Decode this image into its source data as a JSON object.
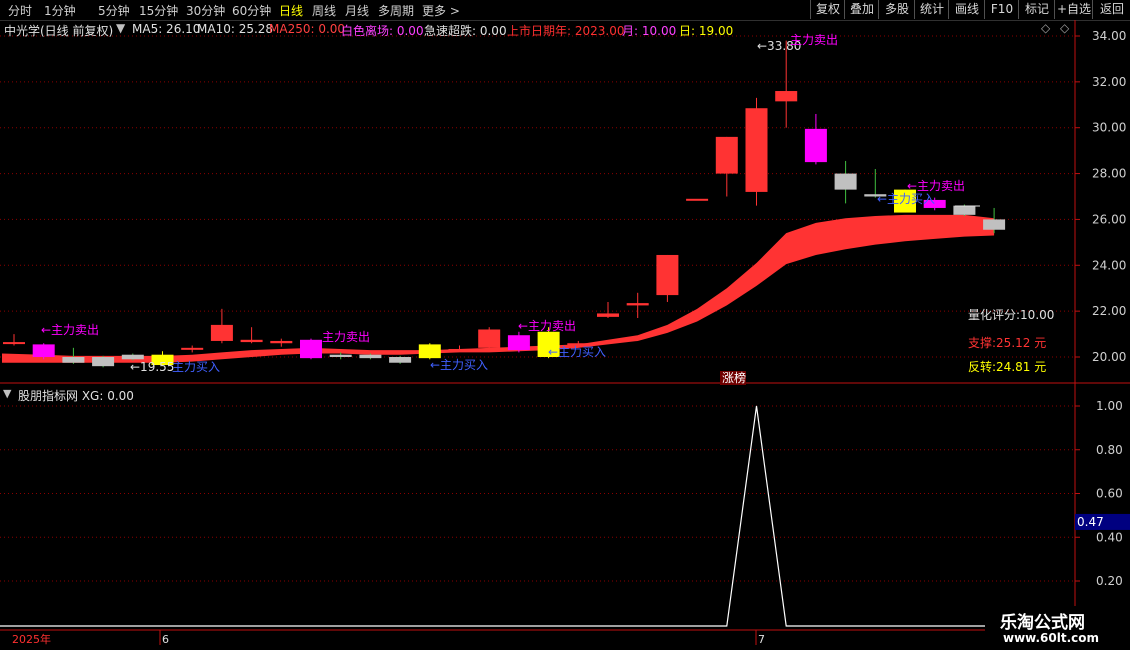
{
  "toolbar": {
    "tabs": [
      "分时",
      "1分钟",
      "5分钟",
      "15分钟",
      "30分钟",
      "60分钟",
      "日线",
      "周线",
      "月线",
      "多周期",
      "更多 >"
    ],
    "active_tab": "日线",
    "right_buttons": [
      "复权",
      "叠加",
      "多股",
      "统计",
      "画线",
      "F10",
      "标记",
      "+自选",
      "返回"
    ]
  },
  "info": {
    "title": "中光学(日线 前复权)",
    "ma5": "MA5: 26.10",
    "ma10": "MA10: 25.28",
    "ma250": "MA250: 0.00",
    "white_leave": "白色离场: 0.00",
    "rapid_drop": "急速超跌: 0.00",
    "listing_day": "上市日期年: 2023.00",
    "month": "月: 10.00",
    "day": "日: 19.00"
  },
  "colors": {
    "up": "#ff3333",
    "down": "#00c0c0",
    "band": "#ff3333",
    "magenta": "#ff00ff",
    "yellow": "#ffff00",
    "gray": "#c0c0c0",
    "grid": "#8b0000",
    "axis": "#c01010"
  },
  "price_axis": {
    "ticks": [
      "34.00",
      "32.00",
      "30.00",
      "28.00",
      "26.00",
      "24.00",
      "22.00",
      "20.00"
    ],
    "min": 19.2,
    "max": 34.3
  },
  "panel": {
    "score": "量化评分:10.00",
    "support": "支撑:25.12 元",
    "reversal": "反转:24.81 元",
    "limit_up": "涨榜"
  },
  "annotations": {
    "max_price": "33.80",
    "min_price": "19.55",
    "sell": "←主力卖出",
    "buy": "←主力买入",
    "sell_top": "主力卖出"
  },
  "candles": [
    {
      "o": 20.65,
      "c": 20.65,
      "h": 21.0,
      "l": 20.5,
      "k": "red"
    },
    {
      "o": 20.0,
      "c": 20.55,
      "h": 20.6,
      "l": 19.9,
      "k": "magenta"
    },
    {
      "o": 20.0,
      "c": 19.75,
      "h": 20.4,
      "l": 19.7,
      "k": "gray"
    },
    {
      "o": 20.0,
      "c": 19.6,
      "h": 20.05,
      "l": 19.55,
      "k": "gray"
    },
    {
      "o": 20.1,
      "c": 19.9,
      "h": 20.15,
      "l": 19.85,
      "k": "gray"
    },
    {
      "o": 19.65,
      "c": 20.1,
      "h": 20.25,
      "l": 19.6,
      "k": "yellow"
    },
    {
      "o": 20.4,
      "c": 20.35,
      "h": 20.5,
      "l": 20.2,
      "k": "red"
    },
    {
      "o": 20.7,
      "c": 21.4,
      "h": 22.1,
      "l": 20.6,
      "k": "red"
    },
    {
      "o": 20.75,
      "c": 20.65,
      "h": 21.3,
      "l": 20.6,
      "k": "red"
    },
    {
      "o": 20.7,
      "c": 20.6,
      "h": 20.8,
      "l": 20.45,
      "k": "red"
    },
    {
      "o": 19.95,
      "c": 20.75,
      "h": 20.8,
      "l": 19.9,
      "k": "magenta"
    },
    {
      "o": 20.1,
      "c": 20.0,
      "h": 20.2,
      "l": 19.9,
      "k": "gray"
    },
    {
      "o": 20.1,
      "c": 19.95,
      "h": 20.15,
      "l": 19.9,
      "k": "gray"
    },
    {
      "o": 20.0,
      "c": 19.75,
      "h": 20.05,
      "l": 19.7,
      "k": "gray"
    },
    {
      "o": 19.95,
      "c": 20.55,
      "h": 20.6,
      "l": 19.9,
      "k": "yellow"
    },
    {
      "o": 20.35,
      "c": 20.35,
      "h": 20.5,
      "l": 20.25,
      "k": "red"
    },
    {
      "o": 20.4,
      "c": 21.2,
      "h": 21.3,
      "l": 20.35,
      "k": "red"
    },
    {
      "o": 20.3,
      "c": 20.95,
      "h": 21.1,
      "l": 20.2,
      "k": "magenta"
    },
    {
      "o": 20.0,
      "c": 21.1,
      "h": 21.3,
      "l": 19.95,
      "k": "yellow"
    },
    {
      "o": 20.6,
      "c": 20.6,
      "h": 20.7,
      "l": 20.5,
      "k": "red"
    },
    {
      "o": 21.75,
      "c": 21.9,
      "h": 22.4,
      "l": 21.7,
      "k": "red"
    },
    {
      "o": 22.25,
      "c": 22.35,
      "h": 22.8,
      "l": 21.7,
      "k": "red"
    },
    {
      "o": 22.7,
      "c": 24.45,
      "h": 24.45,
      "l": 22.4,
      "k": "red"
    },
    {
      "o": 26.9,
      "c": 26.9,
      "h": 26.9,
      "l": 26.9,
      "k": "red"
    },
    {
      "o": 28.0,
      "c": 29.6,
      "h": 29.6,
      "l": 27.0,
      "k": "red"
    },
    {
      "o": 27.2,
      "c": 30.85,
      "h": 31.3,
      "l": 26.6,
      "k": "red"
    },
    {
      "o": 31.15,
      "c": 31.6,
      "h": 33.8,
      "l": 30.0,
      "k": "red"
    },
    {
      "o": 29.95,
      "c": 28.5,
      "h": 30.6,
      "l": 28.4,
      "k": "magenta"
    },
    {
      "o": 28.0,
      "c": 27.3,
      "h": 28.55,
      "l": 26.7,
      "k": "gray"
    },
    {
      "o": 27.1,
      "c": 27.0,
      "h": 28.2,
      "l": 26.95,
      "k": "gray"
    },
    {
      "o": 27.3,
      "c": 26.3,
      "h": 27.3,
      "l": 26.3,
      "k": "yellow"
    },
    {
      "o": 26.85,
      "c": 26.5,
      "h": 26.95,
      "l": 26.4,
      "k": "magenta"
    },
    {
      "o": 26.6,
      "c": 26.2,
      "h": 26.65,
      "l": 26.15,
      "k": "gray"
    },
    {
      "o": 26.0,
      "c": 25.55,
      "h": 26.5,
      "l": 25.4,
      "k": "gray"
    }
  ],
  "band": {
    "upper": [
      20.15,
      20.1,
      20.05,
      20.05,
      20.05,
      20.05,
      20.1,
      20.2,
      20.3,
      20.35,
      20.4,
      20.35,
      20.3,
      20.3,
      20.3,
      20.35,
      20.4,
      20.45,
      20.5,
      20.55,
      20.75,
      20.95,
      21.4,
      22.1,
      23.0,
      24.1,
      25.4,
      25.85,
      26.05,
      26.15,
      26.2,
      26.2,
      26.2,
      26.05
    ],
    "lower": [
      19.75,
      19.75,
      19.75,
      19.75,
      19.75,
      19.75,
      19.8,
      19.9,
      20.0,
      20.1,
      20.15,
      20.15,
      20.1,
      20.1,
      20.15,
      20.2,
      20.2,
      20.25,
      20.3,
      20.4,
      20.55,
      20.7,
      21.05,
      21.55,
      22.25,
      23.1,
      24.05,
      24.45,
      24.7,
      24.9,
      25.05,
      25.15,
      25.25,
      25.3
    ]
  },
  "indicator": {
    "title": "股朋指标网 XG: 0.00",
    "ticks": [
      "1.00",
      "0.80",
      "0.60",
      "0.40",
      "0.20"
    ],
    "min": 0.1,
    "max": 1.05,
    "current": "0.47",
    "xg": [
      0,
      0,
      0,
      0,
      0,
      0,
      0,
      0,
      0,
      0,
      0,
      0,
      0,
      0,
      0,
      0,
      0,
      0,
      0,
      0,
      0,
      0,
      0,
      0,
      0,
      1,
      0,
      0,
      0,
      0,
      0,
      0,
      0,
      0
    ]
  },
  "timeline": {
    "labels": [
      "2025年",
      "6",
      "7"
    ]
  },
  "watermark": {
    "brand": "乐淘公式网",
    "url": "www.60lt.com"
  }
}
